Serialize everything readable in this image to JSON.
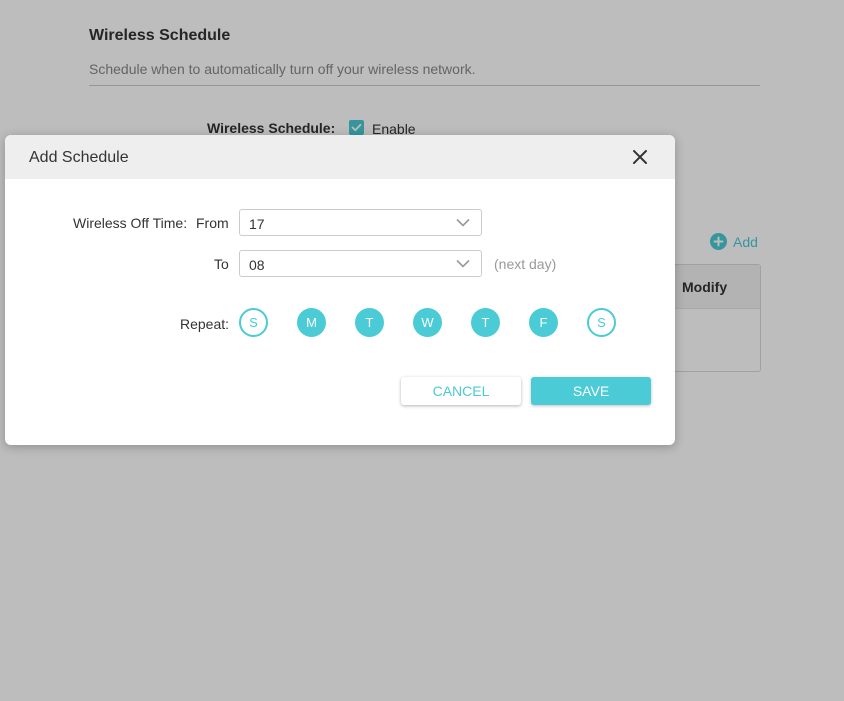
{
  "page": {
    "section_title": "Wireless Schedule",
    "section_desc": "Schedule when to automatically turn off your wireless network.",
    "wireless_schedule_label": "Wireless Schedule:",
    "enable_label": "Enable",
    "enable_checked": true,
    "add_label": "Add",
    "table_header_modify": "Modify"
  },
  "dialog": {
    "title": "Add Schedule",
    "off_time_label": "Wireless Off Time:",
    "from_label": "From",
    "from_value": "17",
    "to_label": "To",
    "to_value": "08",
    "next_day_note": "(next day)",
    "repeat_label": "Repeat:",
    "days": [
      {
        "label": "S",
        "selected": false
      },
      {
        "label": "M",
        "selected": true
      },
      {
        "label": "T",
        "selected": true
      },
      {
        "label": "W",
        "selected": true
      },
      {
        "label": "T",
        "selected": true
      },
      {
        "label": "F",
        "selected": true
      },
      {
        "label": "S",
        "selected": false
      }
    ],
    "cancel_label": "CANCEL",
    "save_label": "SAVE"
  },
  "colors": {
    "accent": "#4acbd6",
    "overlay": "rgba(0,0,0,0.26)"
  },
  "icons": {
    "checkbox": "check-icon",
    "add": "plus-circle-icon",
    "close": "close-icon",
    "dropdown": "chevron-down-icon"
  }
}
